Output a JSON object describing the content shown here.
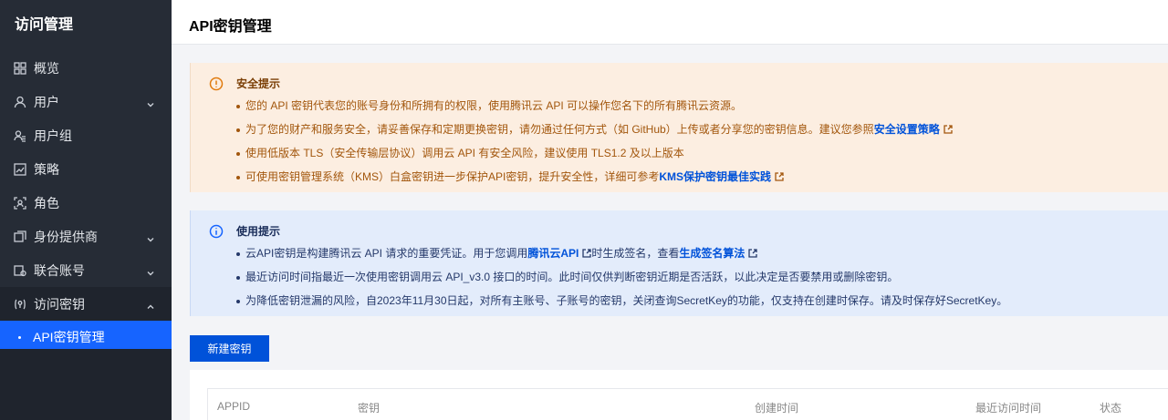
{
  "sidebar": {
    "title": "访问管理",
    "items": [
      {
        "label": "概览",
        "icon": "grid-icon"
      },
      {
        "label": "用户",
        "icon": "user-icon"
      },
      {
        "label": "用户组",
        "icon": "users-icon"
      },
      {
        "label": "策略",
        "icon": "chart-icon"
      },
      {
        "label": "角色",
        "icon": "role-icon"
      },
      {
        "label": "身份提供商",
        "icon": "idp-icon"
      },
      {
        "label": "联合账号",
        "icon": "federated-icon"
      },
      {
        "label": "访问密钥",
        "icon": "key-icon"
      }
    ],
    "sub_item": "API密钥管理"
  },
  "header": {
    "title": "API密钥管理"
  },
  "security_notice": {
    "title": "安全提示",
    "items": [
      "您的 API 密钥代表您的账号身份和所拥有的权限，使用腾讯云 API 可以操作您名下的所有腾讯云资源。",
      {
        "text": "为了您的财产和服务安全，请妥善保存和定期更换密钥，请勿通过任何方式（如 GitHub）上传或者分享您的密钥信息。建议您参照",
        "link": "安全设置策略"
      },
      "使用低版本 TLS（安全传输层协议）调用云 API 有安全风险，建议使用 TLS1.2 及以上版本",
      {
        "text": "可使用密钥管理系统（KMS）白盒密钥进一步保护API密钥，提升安全性，详细可参考",
        "link": "KMS保护密钥最佳实践"
      }
    ]
  },
  "usage_notice": {
    "title": "使用提示",
    "item1": {
      "prefix": "云API密钥是构建腾讯云 API 请求的重要凭证。用于您调用",
      "link1": "腾讯云API",
      "middle": "时生成签名，查看",
      "link2": "生成签名算法"
    },
    "item2": "最近访问时间指最近一次使用密钥调用云 API_v3.0 接口的时间。此时间仅供判断密钥近期是否活跃，以此决定是否要禁用或删除密钥。",
    "item3": "为降低密钥泄漏的风险，自2023年11月30日起，对所有主账号、子账号的密钥，关闭查询SecretKey的功能，仅支持在创建时保存。请及时保存好SecretKey。"
  },
  "create_button": "新建密钥",
  "table": {
    "headers": [
      "APPID",
      "密钥",
      "创建时间",
      "最近访问时间",
      "状态"
    ]
  },
  "colors": {
    "sidebar_bg": "#262c36",
    "accent": "#1664ff",
    "primary_button": "#0052d9",
    "warn_bg": "#fceee1",
    "info_bg": "#e3ecfb"
  }
}
